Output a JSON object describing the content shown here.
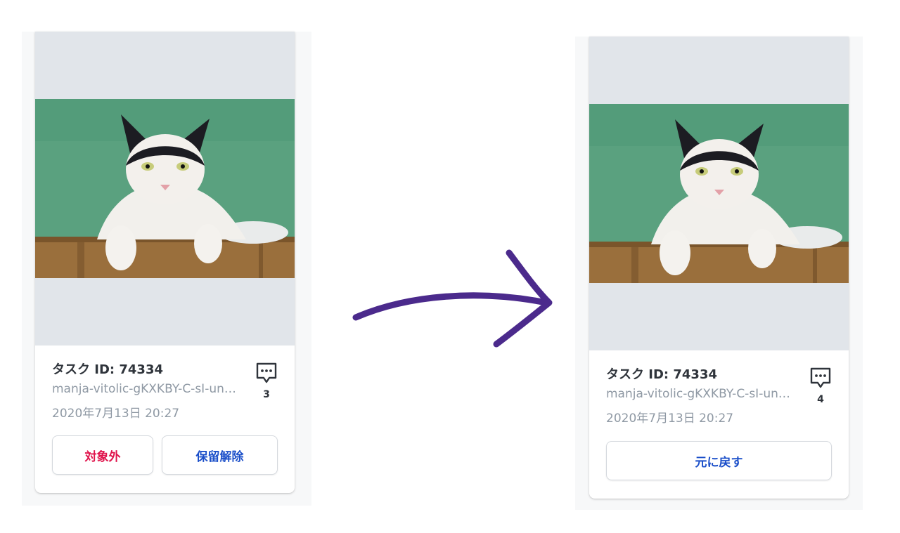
{
  "colors": {
    "image_placeholder": "#e1e5ea",
    "title_text": "#2f343b",
    "muted_text": "#8f99a4",
    "danger": "#e0144c",
    "primary": "#1b4fc9",
    "arrow": "#4b2a8c",
    "photo_background": "#5aa17f"
  },
  "before_card": {
    "task_id_label": "タスク ID: 74334",
    "file_name": "manja-vitolic-gKXKBY-C-sI-unsplash.jpg",
    "date": "2020年7月13日 20:27",
    "comment_icon": "comment-icon",
    "comment_count": "3",
    "actions": {
      "exclude_label": "対象外",
      "release_hold_label": "保留解除"
    }
  },
  "after_card": {
    "task_id_label": "タスク ID: 74334",
    "file_name": "manja-vitolic-gKXKBY-C-sI-unsplash.jpg",
    "date": "2020年7月13日 20:27",
    "comment_icon": "comment-icon",
    "comment_count": "4",
    "actions": {
      "revert_label": "元に戻す"
    }
  },
  "transition_icon": "arrow-right-icon"
}
